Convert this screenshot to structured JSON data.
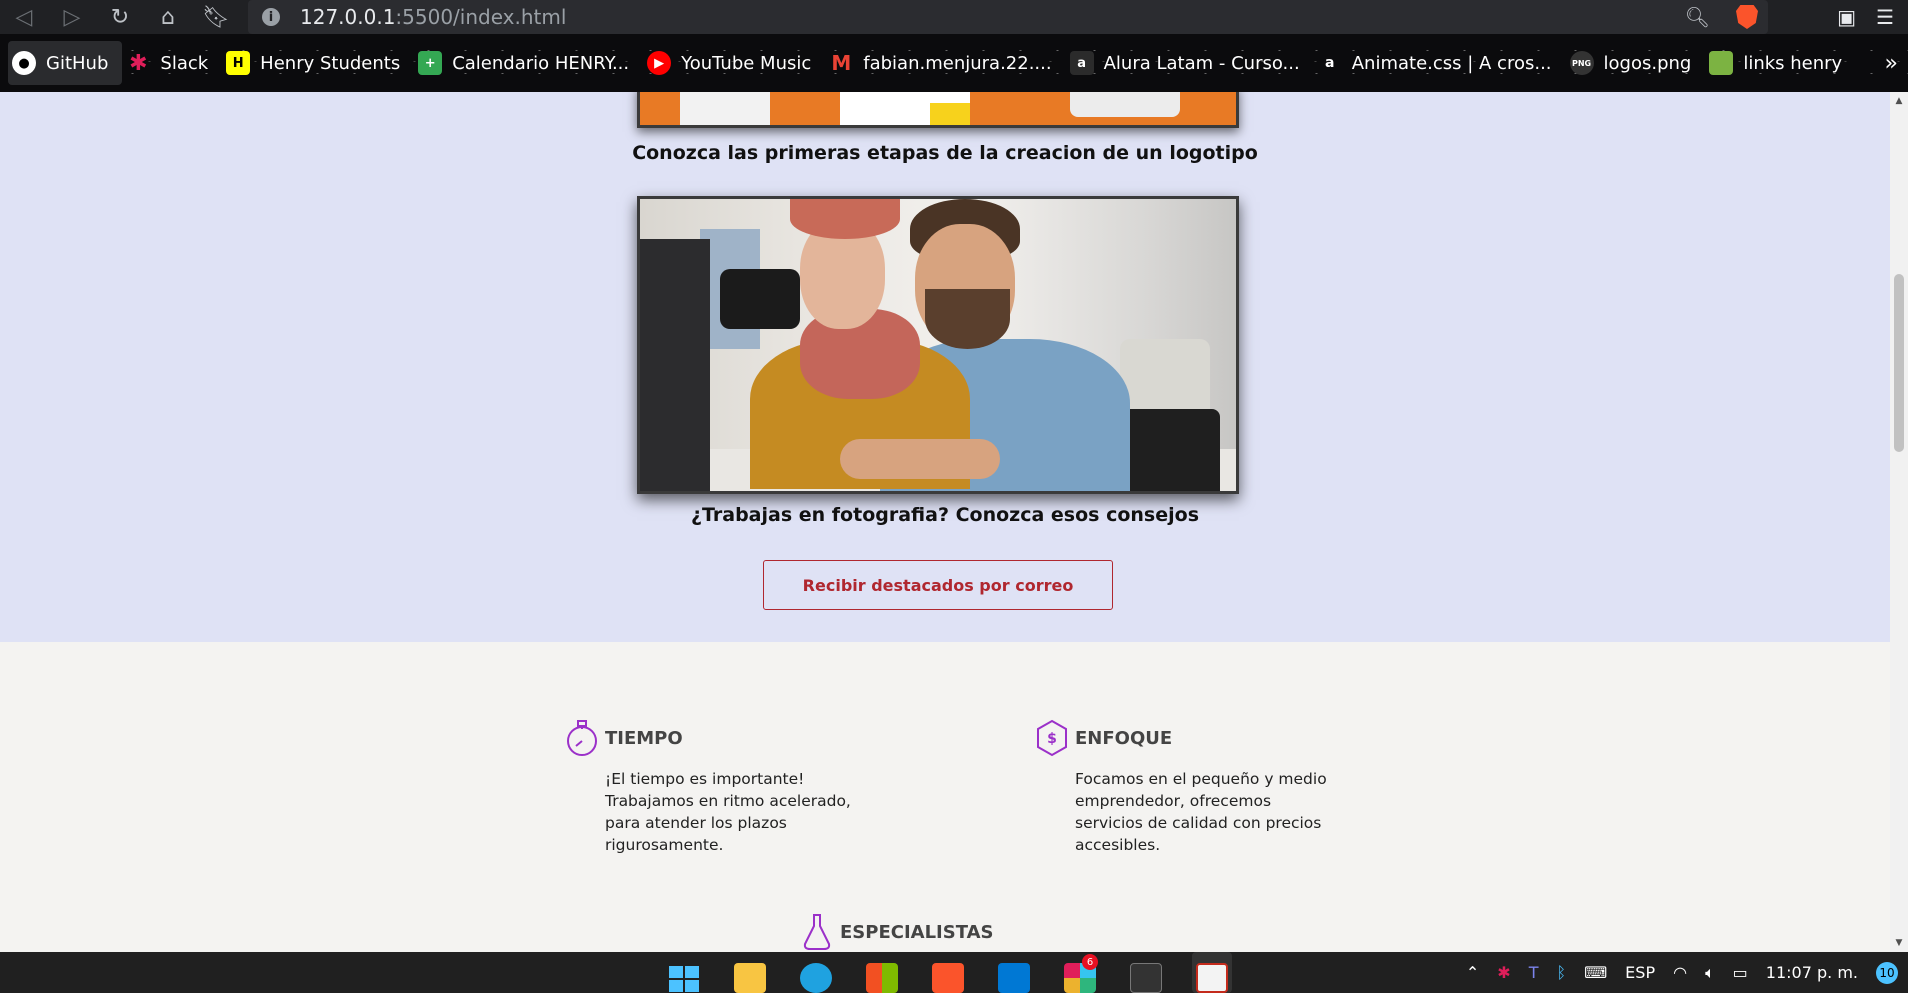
{
  "browser": {
    "url_host": "127.0.0.1",
    "url_path": ":5500/index.html",
    "nav": [
      "back-icon",
      "forward-icon",
      "reload-icon",
      "home-icon",
      "bookmark-icon"
    ]
  },
  "bookmarks": [
    {
      "label": "GitHub",
      "icon": "github-icon",
      "color": "#ffffff"
    },
    {
      "label": "Slack",
      "icon": "slack-icon",
      "color": "#e01e5a"
    },
    {
      "label": "Henry Students",
      "icon": "henry-icon",
      "color": "#ffff01"
    },
    {
      "label": "Calendario HENRY...",
      "icon": "calendar-icon",
      "color": "#34a853"
    },
    {
      "label": "YouTube Music",
      "icon": "youtube-music-icon",
      "color": "#ff0000"
    },
    {
      "label": "fabian.menjura.22....",
      "icon": "gmail-icon",
      "color": "#ea4335"
    },
    {
      "label": "Alura Latam - Curso...",
      "icon": "alura-icon",
      "color": "#2b2b2b"
    },
    {
      "label": "Animate.css | A cros...",
      "icon": "animate-icon",
      "color": "#111111"
    },
    {
      "label": "logos.png",
      "icon": "png-icon",
      "color": "#333333"
    },
    {
      "label": "links henry",
      "icon": "sheet-icon",
      "color": "#7cb342"
    }
  ],
  "blog": {
    "caption1": "Conozca las primeras etapas de la creacion de un logotipo",
    "caption2": "¿Trabajas en fotografia? Conozca esos consejos",
    "cta": "Recibir destacados por correo"
  },
  "features": {
    "tiempo": {
      "title": "TIEMPO",
      "text": "¡El tiempo es importante! Trabajamos en ritmo acelerado, para atender los plazos rigurosamente."
    },
    "enfoque": {
      "title": "ENFOQUE",
      "text": "Focamos en el pequeño y medio emprendedor, ofrecemos servicios de calidad con precios accesibles."
    },
    "especialistas": {
      "title": "ESPECIALISTAS"
    }
  },
  "taskbar": {
    "slack_badge": "6",
    "lang": "ESP",
    "time": "11:07 p. m.",
    "notifications": "10"
  },
  "colors": {
    "accent": "#b0272f",
    "icon_purple": "#9b30c9",
    "blog_bg": "#dfe2f5"
  }
}
